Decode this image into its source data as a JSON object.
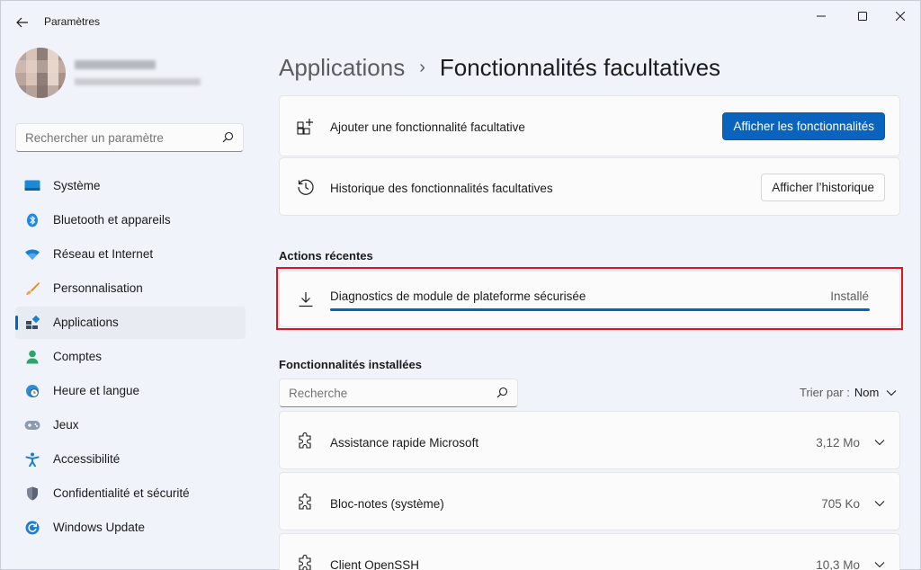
{
  "window": {
    "title": "Paramètres"
  },
  "sidebar": {
    "search_placeholder": "Rechercher un paramètre",
    "items": [
      {
        "label": "Système",
        "icon": "monitor-icon"
      },
      {
        "label": "Bluetooth et appareils",
        "icon": "bluetooth-icon"
      },
      {
        "label": "Réseau et Internet",
        "icon": "wifi-icon"
      },
      {
        "label": "Personnalisation",
        "icon": "brush-icon"
      },
      {
        "label": "Applications",
        "icon": "apps-icon",
        "selected": true
      },
      {
        "label": "Comptes",
        "icon": "person-icon"
      },
      {
        "label": "Heure et langue",
        "icon": "globe-clock-icon"
      },
      {
        "label": "Jeux",
        "icon": "gamepad-icon"
      },
      {
        "label": "Accessibilité",
        "icon": "accessibility-icon"
      },
      {
        "label": "Confidentialité et sécurité",
        "icon": "shield-icon"
      },
      {
        "label": "Windows Update",
        "icon": "update-icon"
      }
    ]
  },
  "breadcrumb": {
    "parent": "Applications",
    "separator": "›",
    "current": "Fonctionnalités facultatives"
  },
  "add_feature": {
    "label": "Ajouter une fonctionnalité facultative",
    "button": "Afficher les fonctionnalités"
  },
  "history": {
    "label": "Historique des fonctionnalités facultatives",
    "button": "Afficher l’historique"
  },
  "recent": {
    "title": "Actions récentes",
    "item_label": "Diagnostics de module de plateforme sécurisée",
    "status": "Installé",
    "progress_percent": 100
  },
  "installed": {
    "title": "Fonctionnalités installées",
    "search_placeholder": "Recherche",
    "sort_label": "Trier par :",
    "sort_value": "Nom",
    "items": [
      {
        "name": "Assistance rapide Microsoft",
        "size": "3,12 Mo"
      },
      {
        "name": "Bloc-notes (système)",
        "size": "705 Ko"
      },
      {
        "name": "Client OpenSSH",
        "size": "10,3 Mo"
      }
    ]
  },
  "colors": {
    "accent": "#0a64bd",
    "highlight_border": "#e4141e"
  }
}
